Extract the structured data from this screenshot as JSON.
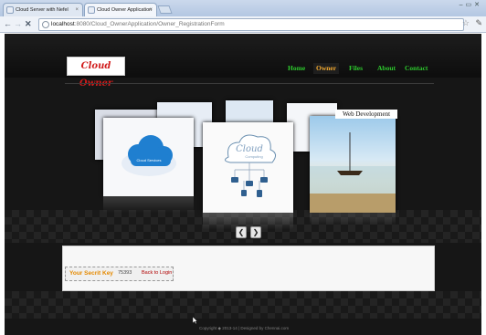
{
  "browser": {
    "tabs": [
      {
        "title": "Cloud Server with Nefel"
      },
      {
        "title": "Cloud Owner Application"
      }
    ],
    "url_host": "localhost",
    "url_path": ":8080/Cloud_OwnerApplication/Owner_RegistrationForm"
  },
  "site": {
    "logo_text": "Cloud Owner",
    "nav": [
      {
        "label": "Home",
        "active": false
      },
      {
        "label": "Owner",
        "active": true
      },
      {
        "label": "Files",
        "active": false
      },
      {
        "label": "About",
        "active": false
      },
      {
        "label": "Contact",
        "active": false
      }
    ]
  },
  "carousel": {
    "caption": "Web Development",
    "center_logo_text": "Cloud",
    "center_logo_sub": "Computing",
    "left_logo_text": "Cloud Services",
    "prev_symbol": "❮",
    "next_symbol": "❯"
  },
  "panel": {
    "secret_key_label": "Your Secrit Key",
    "secret_key_value": "75393",
    "back_link": "Back to Login"
  },
  "footer": {
    "text": "Copyright ◆ 2013-14 | Designed by Chennai.com"
  },
  "colors": {
    "nav_green": "#2dc92d",
    "nav_active": "#f0a830",
    "logo_red": "#d11b1b",
    "key_label": "#e58a00",
    "link_red": "#b00000"
  },
  "icons": [
    "globe-icon",
    "star-icon",
    "wrench-icon",
    "back-icon",
    "forward-icon",
    "close-icon"
  ]
}
